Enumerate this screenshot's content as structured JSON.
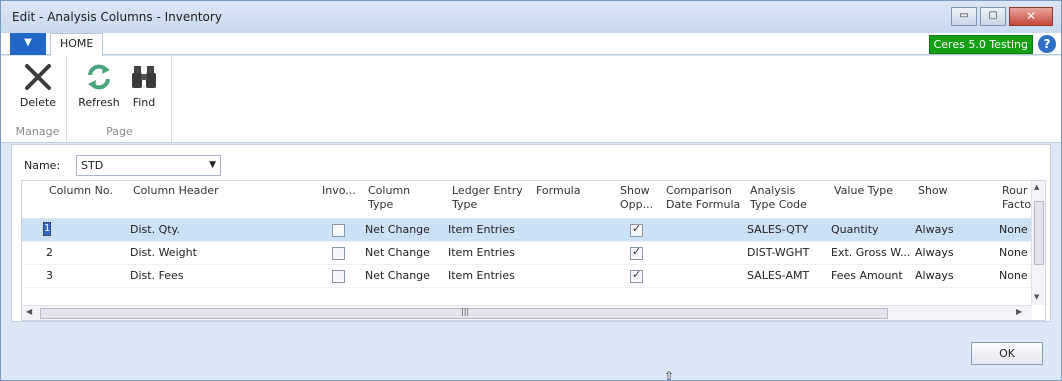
{
  "window": {
    "title": "Edit - Analysis Columns - Inventory",
    "minimize": "▭",
    "maximize": "▢",
    "close": "✕"
  },
  "ribbon_tabs": {
    "app_menu": "▼",
    "home": "HOME",
    "company": "Ceres 5.0 Testing",
    "help": "?"
  },
  "ribbon": {
    "groups": [
      {
        "label": "Manage",
        "buttons": [
          {
            "label": "Delete",
            "icon": "delete-x-icon"
          }
        ]
      },
      {
        "label": "Page",
        "buttons": [
          {
            "label": "Refresh",
            "icon": "refresh-icon"
          },
          {
            "label": "Find",
            "icon": "binoculars-icon"
          }
        ]
      }
    ]
  },
  "filter": {
    "label": "Name:",
    "value": "STD"
  },
  "grid": {
    "columns": [
      "Column No.",
      "Column Header",
      "Invo...",
      "Column Type",
      "Ledger Entry Type",
      "Formula",
      "Show Opp...",
      "Comparison Date Formula",
      "Analysis Type Code",
      "Value Type",
      "Show",
      "Rour Facto"
    ],
    "rows": [
      {
        "column_no": "1",
        "header": "Dist. Qty.",
        "invoiced": false,
        "column_type": "Net Change",
        "ledger_entry_type": "Item Entries",
        "formula": "",
        "show_opposite": true,
        "comparison": "",
        "analysis_type_code": "SALES-QTY",
        "value_type": "Quantity",
        "show": "Always",
        "rounding": "None"
      },
      {
        "column_no": "2",
        "header": "Dist. Weight",
        "invoiced": false,
        "column_type": "Net Change",
        "ledger_entry_type": "Item Entries",
        "formula": "",
        "show_opposite": true,
        "comparison": "",
        "analysis_type_code": "DIST-WGHT",
        "value_type": "Ext. Gross W...",
        "show": "Always",
        "rounding": "None"
      },
      {
        "column_no": "3",
        "header": "Dist. Fees",
        "invoiced": false,
        "column_type": "Net Change",
        "ledger_entry_type": "Item Entries",
        "formula": "",
        "show_opposite": true,
        "comparison": "",
        "analysis_type_code": "SALES-AMT",
        "value_type": "Fees Amount",
        "show": "Always",
        "rounding": "None"
      }
    ]
  },
  "footer": {
    "ok_label": "OK"
  },
  "colors": {
    "accent": "#1f66c6",
    "company_badge": "#13a013",
    "selected_row": "#cce0f7"
  }
}
